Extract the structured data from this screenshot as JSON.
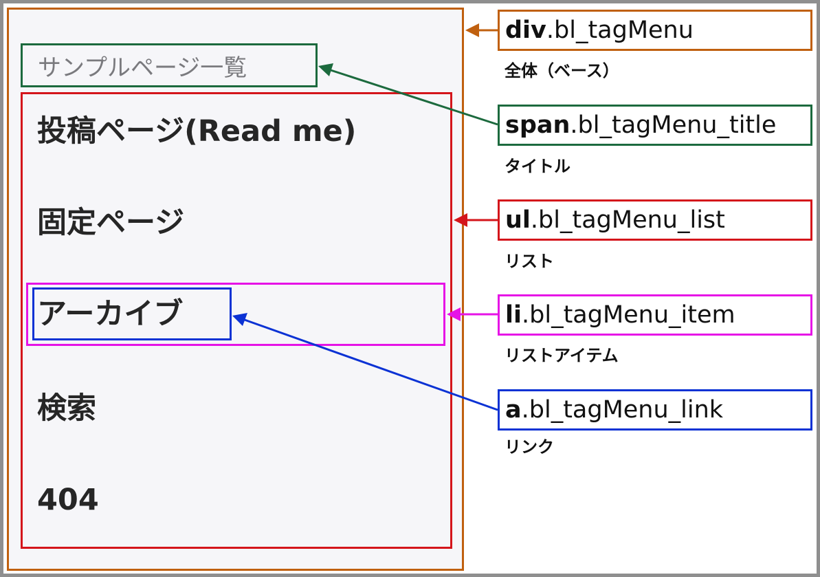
{
  "diagram": {
    "menu_title": "サンプルページ一覧",
    "menu_items": [
      {
        "label": "投稿ページ(Read me)"
      },
      {
        "label": "固定ページ"
      },
      {
        "label": "アーカイブ"
      },
      {
        "label": "検索"
      },
      {
        "label": "404"
      }
    ],
    "annotations": [
      {
        "tag": "div",
        "class_name": ".bl_tagMenu",
        "description": "全体（ベース）",
        "color": "#c0600f"
      },
      {
        "tag": "span",
        "class_name": ".bl_tagMenu_title",
        "description": "タイトル",
        "color": "#1c6a3e"
      },
      {
        "tag": "ul",
        "class_name": ".bl_tagMenu_list",
        "description": "リスト",
        "color": "#d4151b"
      },
      {
        "tag": "li",
        "class_name": ".bl_tagMenu_item",
        "description": "リストアイテム",
        "color": "#e613e6"
      },
      {
        "tag": "a",
        "class_name": ".bl_tagMenu_link",
        "description": "リンク",
        "color": "#0b32d4"
      }
    ]
  }
}
